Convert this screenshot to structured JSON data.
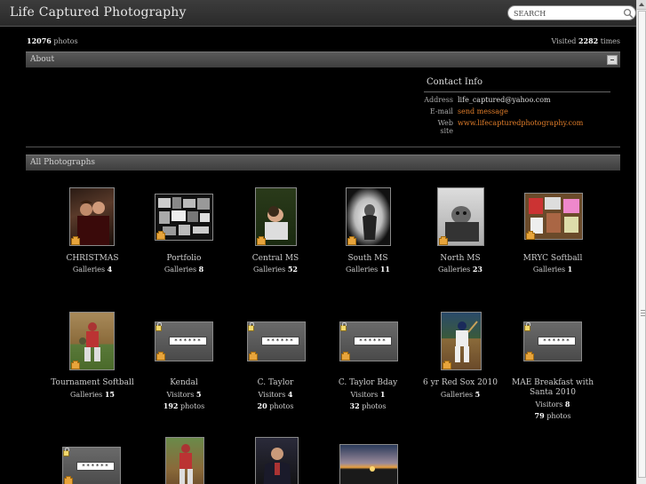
{
  "header": {
    "site_title": "Life Captured Photography",
    "search_placeholder": "SEARCH"
  },
  "stats": {
    "photo_count": "12076",
    "photo_label": "photos",
    "visited_label": "Visited",
    "visit_count": "2282",
    "times_label": "times"
  },
  "about": {
    "label": "About"
  },
  "contact": {
    "title": "Contact Info",
    "rows": [
      {
        "key": "Address",
        "value": "life_captured@yahoo.com"
      },
      {
        "key": "E-mail",
        "value": "send message"
      },
      {
        "key": "Web site",
        "value": "www.lifecapturedphotography.com"
      }
    ]
  },
  "photographs": {
    "label": "All Photographs"
  },
  "albums": [
    {
      "name": "CHRISTMAS",
      "stat_label": "Galleries",
      "stat_value": "4"
    },
    {
      "name": "Portfolio",
      "stat_label": "Galleries",
      "stat_value": "8"
    },
    {
      "name": "Central MS",
      "stat_label": "Galleries",
      "stat_value": "52"
    },
    {
      "name": "South MS",
      "stat_label": "Galleries",
      "stat_value": "11"
    },
    {
      "name": "North MS",
      "stat_label": "Galleries",
      "stat_value": "23"
    },
    {
      "name": "MRYC Softball",
      "stat_label": "Galleries",
      "stat_value": "1"
    },
    {
      "name": "Tournament Softball",
      "stat_label": "Galleries",
      "stat_value": "15"
    },
    {
      "name": "Kendal",
      "stat_label": "Visitors",
      "stat_value": "5",
      "photos": "192",
      "photos_label": "photos",
      "password": "******"
    },
    {
      "name": "C. Taylor",
      "stat_label": "Visitors",
      "stat_value": "4",
      "photos": "20",
      "photos_label": "photos",
      "password": "******"
    },
    {
      "name": "C. Taylor Bday",
      "stat_label": "Visitors",
      "stat_value": "1",
      "photos": "32",
      "photos_label": "photos",
      "password": "******"
    },
    {
      "name": "6 yr Red Sox 2010",
      "stat_label": "Galleries",
      "stat_value": "5"
    },
    {
      "name": "MAE Breakfast with Santa 2010",
      "stat_label": "Visitors",
      "stat_value": "8",
      "photos": "79",
      "photos_label": "photos",
      "password": "******"
    },
    {
      "password": "******"
    }
  ],
  "colors": {
    "accent_link": "#e07d2a",
    "folder_icon": "#e7a43b"
  }
}
